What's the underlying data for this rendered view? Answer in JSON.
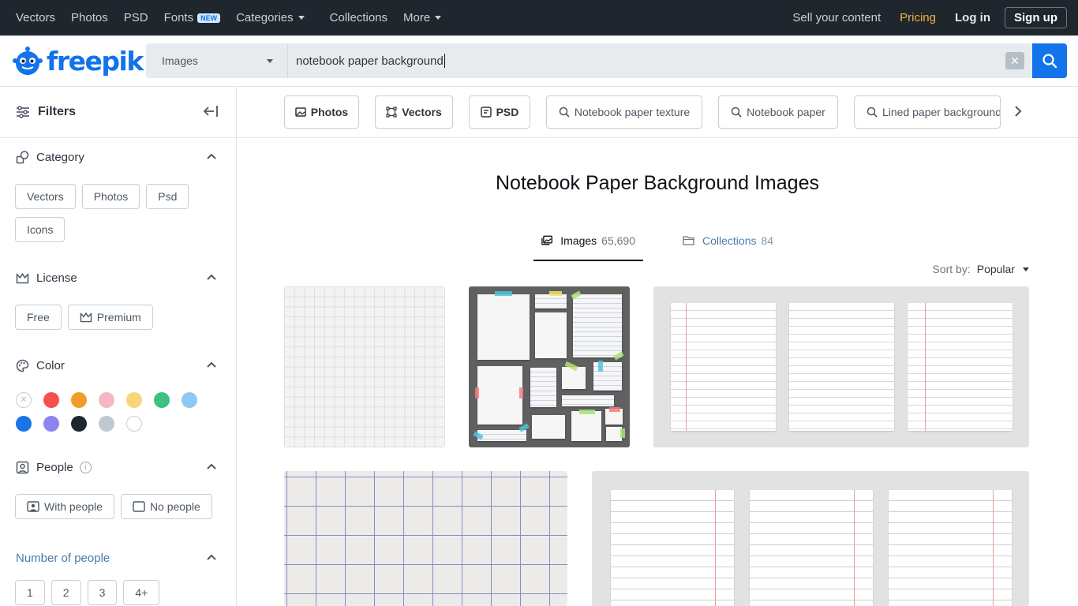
{
  "topnav": {
    "items": [
      "Vectors",
      "Photos",
      "PSD",
      "Fonts",
      "Categories",
      "Collections",
      "More"
    ],
    "new_badge": "NEW",
    "sell": "Sell your content",
    "pricing": "Pricing",
    "login": "Log in",
    "signup": "Sign up"
  },
  "brand": {
    "name": "freepik",
    "color": "#1273eb"
  },
  "search": {
    "type": "Images",
    "query": "notebook paper background",
    "clear_icon": "close-icon",
    "button_icon": "search-icon"
  },
  "sidebar": {
    "title": "Filters",
    "category": {
      "label": "Category",
      "options": [
        "Vectors",
        "Photos",
        "Psd",
        "Icons"
      ]
    },
    "license": {
      "label": "License",
      "options": [
        "Free",
        "Premium"
      ]
    },
    "color": {
      "label": "Color",
      "swatches": [
        "none",
        "#f45050",
        "#f59b2b",
        "#f6b6c5",
        "#f8d57a",
        "#3cc083",
        "#8ec8f5",
        "#1a73e8",
        "#8c85f0",
        "#1f262d",
        "#c0c8d0",
        "#ffffff"
      ]
    },
    "people": {
      "label": "People",
      "info": "i",
      "options": [
        "With people",
        "No people"
      ]
    },
    "number_of_people": {
      "label": "Number of people",
      "options": [
        "1",
        "2",
        "3",
        "4+"
      ]
    }
  },
  "tags": [
    "Photos",
    "Vectors",
    "PSD",
    "Notebook paper texture",
    "Notebook paper",
    "Lined paper background"
  ],
  "main": {
    "title": "Notebook Paper Background Images",
    "tabs": [
      {
        "label": "Images",
        "count": "65,690"
      },
      {
        "label": "Collections",
        "count": "84"
      }
    ],
    "sort_label": "Sort by:",
    "sort_value": "Popular"
  }
}
